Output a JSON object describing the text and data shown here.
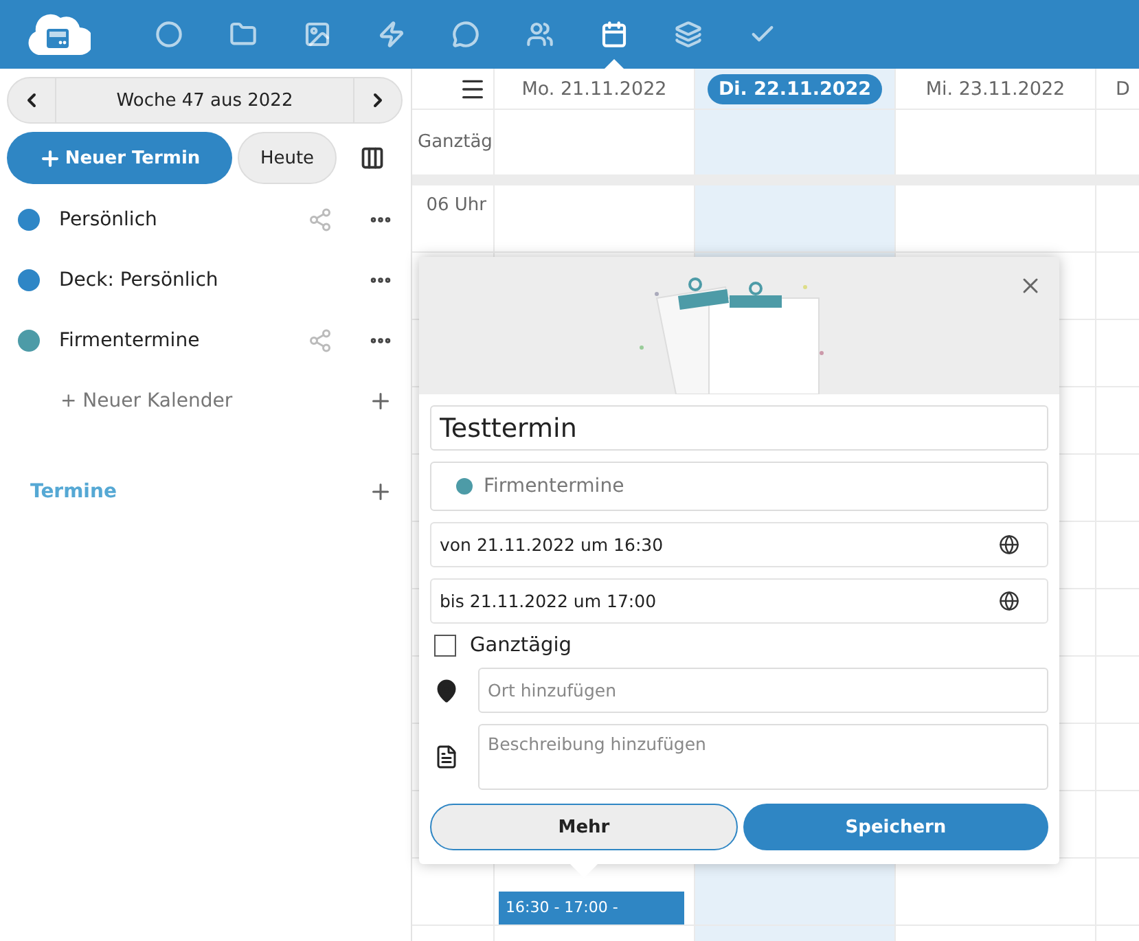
{
  "top_bar": {
    "apps": [
      {
        "kind": "circle",
        "selected": false
      },
      {
        "kind": "folder",
        "selected": false
      },
      {
        "kind": "image",
        "selected": false
      },
      {
        "kind": "bolt",
        "selected": false
      },
      {
        "kind": "chat",
        "selected": false
      },
      {
        "kind": "contacts",
        "selected": false
      },
      {
        "kind": "calendar",
        "selected": true
      },
      {
        "kind": "stack",
        "selected": false
      },
      {
        "kind": "check",
        "selected": false
      }
    ]
  },
  "sidebar": {
    "week_label": "Woche 47 aus 2022",
    "new_event": "Neuer Termin",
    "today": "Heute",
    "calendars": [
      {
        "name": "Persönlich",
        "color": "#2e86c6",
        "shared": true
      },
      {
        "name": "Deck: Persönlich",
        "color": "#2e86c6",
        "shared": false
      },
      {
        "name": "Firmentermine",
        "color": "#4d9ba7",
        "shared": true
      }
    ],
    "new_calendar": "+ Neuer Kalender",
    "section": "Termine"
  },
  "calendar": {
    "days": [
      {
        "label": "Mo. 21.11.2022",
        "selected": false,
        "event": "16:30 - 17:00 -"
      },
      {
        "label": "Di. 22.11.2022",
        "selected": true
      },
      {
        "label": "Mi. 23.11.2022",
        "selected": false
      },
      {
        "label": "D",
        "selected": false
      }
    ],
    "all_day_label": "Ganztäg",
    "hours": [
      "06 Uhr"
    ]
  },
  "popover": {
    "title": "Testtermin",
    "calendar": {
      "name": "Firmentermine",
      "color": "#4d9ba7"
    },
    "from": "von 21.11.2022 um 16:30",
    "to": "bis 21.11.2022 um 17:00",
    "all_day": {
      "label": "Ganztägig",
      "checked": false
    },
    "location": {
      "placeholder": "Ort hinzufügen"
    },
    "description": {
      "placeholder": "Beschreibung hinzufügen"
    },
    "buttons": [
      {
        "label": "Mehr",
        "kind": "secondary"
      },
      {
        "label": "Speichern",
        "kind": "primary"
      }
    ]
  }
}
